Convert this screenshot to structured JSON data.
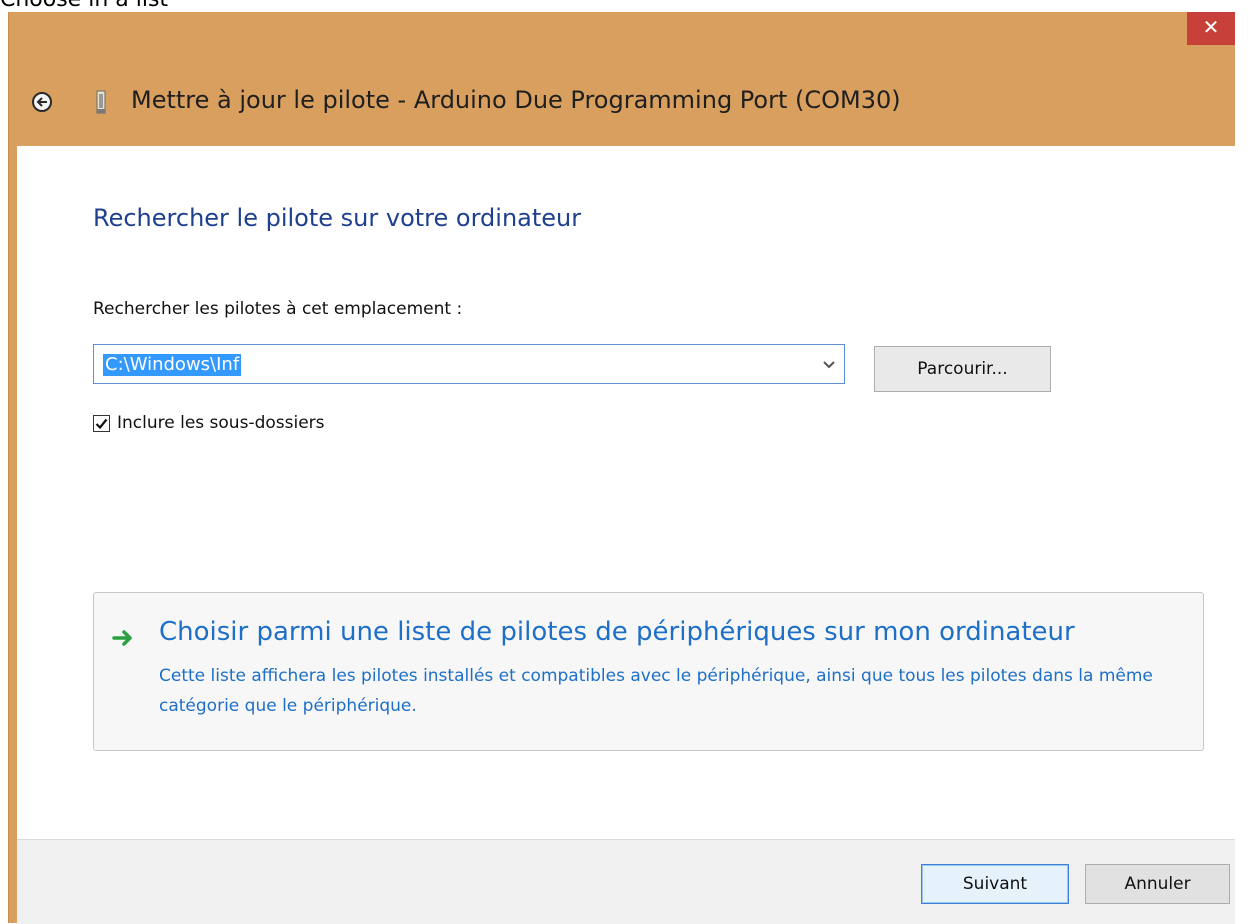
{
  "caption": "Choose in a list",
  "window": {
    "title": "Mettre à jour le pilote - Arduino Due Programming Port (COM30)",
    "close_glyph": "✕"
  },
  "content": {
    "section_title": "Rechercher le pilote sur votre ordinateur",
    "field_label": "Rechercher les pilotes à cet emplacement :",
    "path_value": "C:\\Windows\\Inf",
    "browse_label": "Parcourir...",
    "include_subfolders_label": "Inclure les sous-dossiers",
    "include_subfolders_checked": true,
    "choose_option": {
      "title": "Choisir parmi une liste de pilotes de périphériques sur mon ordinateur",
      "description": "Cette liste affichera les pilotes installés et compatibles avec le périphérique, ainsi que tous les pilotes dans la même catégorie que le périphérique."
    }
  },
  "footer": {
    "next_label": "Suivant",
    "cancel_label": "Annuler"
  },
  "colors": {
    "titlebar": "#d89f5e",
    "close_button": "#c7403a",
    "link_blue": "#1e6fc8",
    "heading_blue": "#1f3f8f",
    "selection": "#3399ff"
  },
  "icons": {
    "back": "back-arrow-icon",
    "device": "usb-device-icon",
    "option_arrow": "green-arrow-icon",
    "dropdown": "chevron-down-icon",
    "check": "checkmark-icon"
  }
}
